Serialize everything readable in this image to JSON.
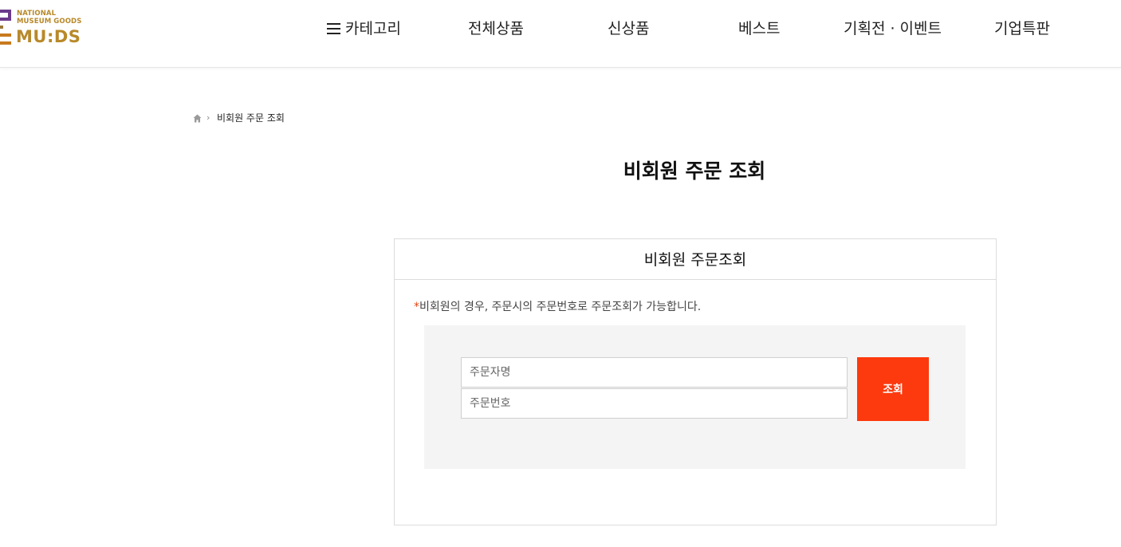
{
  "brand": {
    "tagline": "NATIONAL MUSEUM GOODS",
    "tagline_line1": "NATIONAL",
    "tagline_line2": "MUSEUM GOODS",
    "name": "MU:DS",
    "colors": {
      "purple": "#6b3a8a",
      "gold": "#b8892a"
    }
  },
  "nav": {
    "category_label": "카테고리",
    "items": [
      {
        "label": "전체상품"
      },
      {
        "label": "신상품"
      },
      {
        "label": "베스트"
      },
      {
        "label": "기획전 · 이벤트"
      },
      {
        "label": "기업특판"
      }
    ]
  },
  "breadcrumb": {
    "current": "비회원 주문 조회"
  },
  "page": {
    "title": "비회원 주문 조회"
  },
  "lookup_panel": {
    "heading": "비회원 주문조회",
    "notice_star": "*",
    "notice_text": "비회원의 경우, 주문시의 주문번호로 주문조회가 가능합니다.",
    "name_placeholder": "주문자명",
    "number_placeholder": "주문번호",
    "submit_label": "조회",
    "accent_color": "#fc3a0e"
  }
}
